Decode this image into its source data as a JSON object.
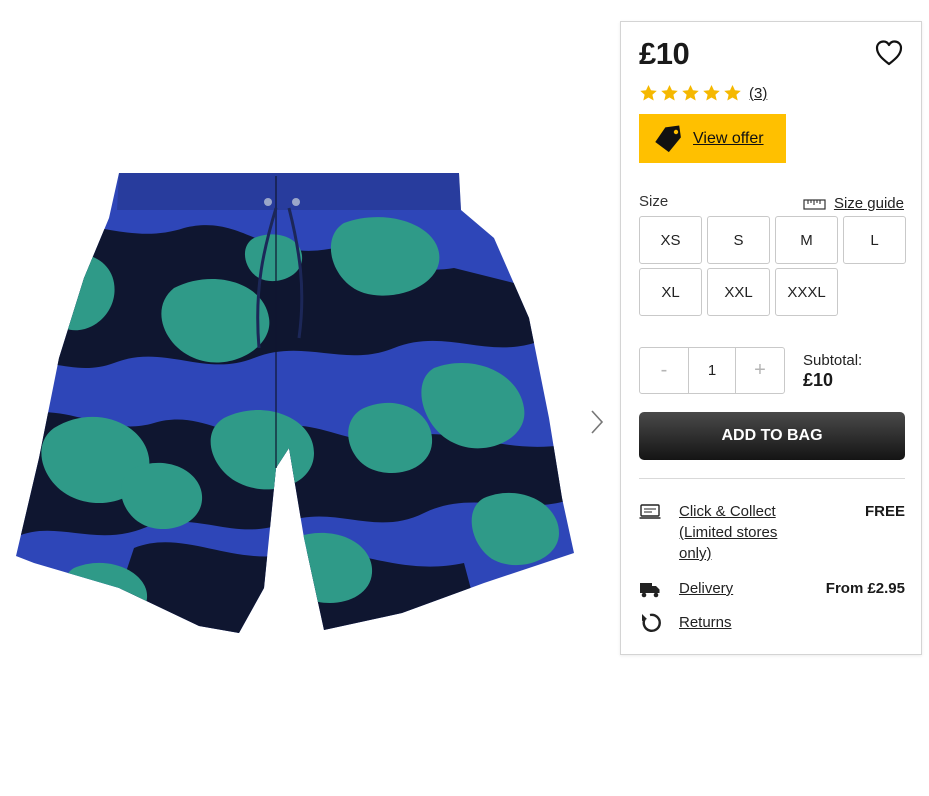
{
  "gallery": {
    "next_icon": "chevron-right-icon",
    "image_alt": "Blue camouflage swim shorts",
    "colors": {
      "navy": "#0f1630",
      "royal_blue": "#2e46b8",
      "teal": "#2f9a88"
    }
  },
  "product": {
    "price": "£10",
    "wishlist_icon": "heart-outline-icon",
    "rating": {
      "stars": 5,
      "out_of": 5,
      "count_label": "(3)",
      "star_color": "#f5b800"
    }
  },
  "offer": {
    "label": "View offer",
    "icon": "tag-icon",
    "color": "#ffc000"
  },
  "size": {
    "heading": "Size",
    "guide_label": "Size guide",
    "guide_icon": "ruler-icon",
    "options": [
      "XS",
      "S",
      "M",
      "L",
      "XL",
      "XXL",
      "XXXL"
    ]
  },
  "quantity": {
    "minus": "-",
    "value": "1",
    "plus": "+"
  },
  "subtotal": {
    "label": "Subtotal:",
    "value": "£10"
  },
  "add_to_bag": {
    "label": "ADD TO BAG"
  },
  "delivery": {
    "collect": {
      "label": "Click & Collect (Limited stores only)",
      "price": "FREE",
      "icon": "click-collect-icon"
    },
    "home": {
      "label": "Delivery",
      "price": "From £2.95",
      "icon": "truck-icon"
    },
    "returns": {
      "label": "Returns",
      "icon": "returns-icon"
    }
  }
}
